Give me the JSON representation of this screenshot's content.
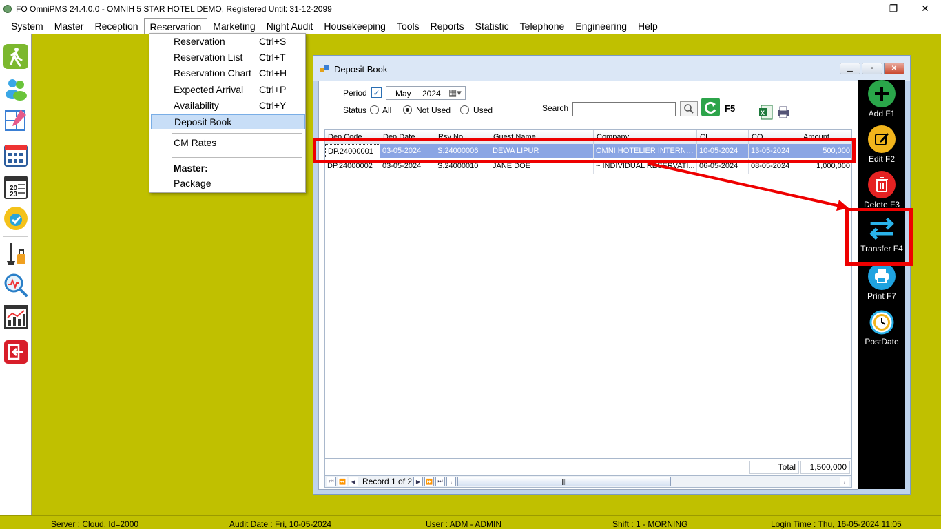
{
  "window": {
    "title": "FO OmniPMS 24.4.0.0 - OMNIH 5 STAR HOTEL DEMO, Registered Until: 31-12-2099",
    "minimize": "—",
    "restore": "❐",
    "close": "✕"
  },
  "menubar": [
    "System",
    "Master",
    "Reception",
    "Reservation",
    "Marketing",
    "Night Audit",
    "Housekeeping",
    "Tools",
    "Reports",
    "Statistic",
    "Telephone",
    "Engineering",
    "Help"
  ],
  "dropdown": {
    "items": [
      {
        "label": "Reservation",
        "shortcut": "Ctrl+S"
      },
      {
        "label": "Reservation List",
        "shortcut": "Ctrl+T"
      },
      {
        "label": "Reservation Chart",
        "shortcut": "Ctrl+H"
      },
      {
        "label": "Expected Arrival",
        "shortcut": "Ctrl+P"
      },
      {
        "label": "Availability",
        "shortcut": "Ctrl+Y"
      },
      {
        "label": "Deposit Book",
        "shortcut": ""
      },
      {
        "label": "CM Rates",
        "shortcut": ""
      },
      {
        "label": "Master:",
        "shortcut": ""
      },
      {
        "label": "Package",
        "shortcut": ""
      }
    ]
  },
  "deposit_book": {
    "title": "Deposit Book",
    "period_label": "Period",
    "period_month": "May",
    "period_year": "2024",
    "status_label": "Status",
    "status_options": [
      "All",
      "Not Used",
      "Used"
    ],
    "status_selected": "Not Used",
    "search_label": "Search",
    "search_value": "",
    "refresh_key": "F5",
    "columns": [
      "Dep Code",
      "Dep Date",
      "Rsv No",
      "Guest Name",
      "Company",
      "CI",
      "CO",
      "Amount"
    ],
    "rows": [
      [
        "DP.24000001",
        "03-05-2024",
        "S.24000006",
        "DEWA LIPUR",
        "OMNI HOTELIER INTERNAS...",
        "10-05-2024",
        "13-05-2024",
        "500,000"
      ],
      [
        "DP.24000002",
        "03-05-2024",
        "S.24000010",
        "JANE DOE",
        "~ INDIVIDUAL RESERVATI...",
        "06-05-2024",
        "08-05-2024",
        "1,000,000"
      ]
    ],
    "total_label": "Total",
    "total_value": "1,500,000",
    "record_text": "Record 1 of 2"
  },
  "actions": [
    {
      "label": "Add F1",
      "icon": "add-icon",
      "color": "#2aa64a"
    },
    {
      "label": "Edit F2",
      "icon": "edit-icon",
      "color": "#f2b51c"
    },
    {
      "label": "Delete F3",
      "icon": "delete-icon",
      "color": "#e52222"
    },
    {
      "label": "Transfer F4",
      "icon": "transfer-icon",
      "color": "#1fa3e0"
    },
    {
      "label": "Print F7",
      "icon": "print-icon",
      "color": "#1fa3e0"
    },
    {
      "label": "PostDate",
      "icon": "postdate-icon",
      "color": "#f2b51c"
    }
  ],
  "statusbar": {
    "server": "Server : Cloud, Id=2000",
    "audit_date": "Audit Date : Fri, 10-05-2024",
    "user": "User : ADM - ADMIN",
    "shift": "Shift : 1 - MORNING",
    "login_time": "Login Time : Thu, 16-05-2024 11:05"
  },
  "colors": {
    "background": "#c0c000",
    "highlight": "#8aa5e4",
    "annotation": "#ee0000"
  }
}
